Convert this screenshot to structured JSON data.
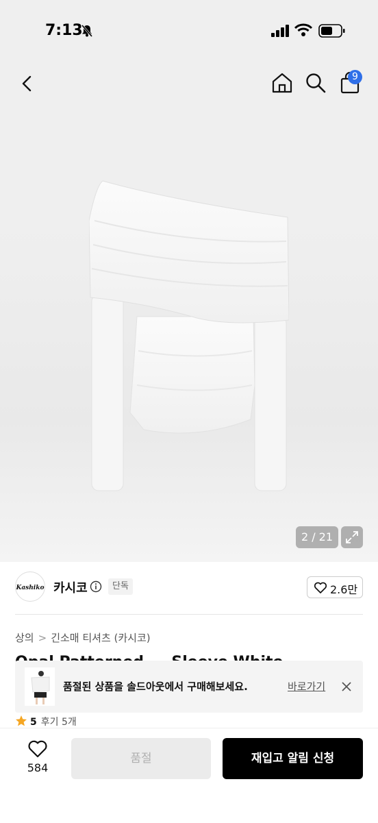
{
  "status_bar": {
    "time": "7:13"
  },
  "header": {
    "cart_count": "9"
  },
  "gallery": {
    "counter": "2 / 21"
  },
  "brand": {
    "logo_text": "Kashiko",
    "name": "카시코",
    "tag": "단독",
    "likes": "2.6만"
  },
  "breadcrumb": {
    "items": [
      "상의",
      "긴소매 티셔츠 (카시코)"
    ]
  },
  "product": {
    "title_partial": "Opal Patterned ... Sleeve White"
  },
  "toast": {
    "message": "품절된 상품을 솔드아웃에서 구매해보세요.",
    "link": "바로가기"
  },
  "rating": {
    "score": "5",
    "reviews": "후기 5개"
  },
  "bottom_bar": {
    "wish_count": "584",
    "soldout_label": "품절",
    "restock_label": "재입고 알림 신청"
  },
  "colors": {
    "accent_badge": "#2f6fe8",
    "primary_button": "#000000",
    "star": "#f5a623"
  }
}
